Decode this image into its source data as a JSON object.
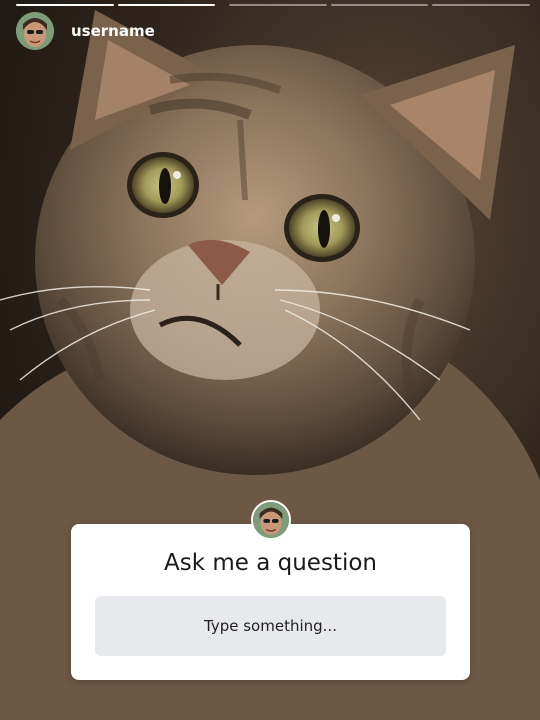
{
  "story": {
    "progress": [
      1,
      1,
      0,
      0,
      0
    ]
  },
  "header": {
    "username": "username"
  },
  "question_sticker": {
    "title": "Ask me a question",
    "input_placeholder": "Type something..."
  }
}
